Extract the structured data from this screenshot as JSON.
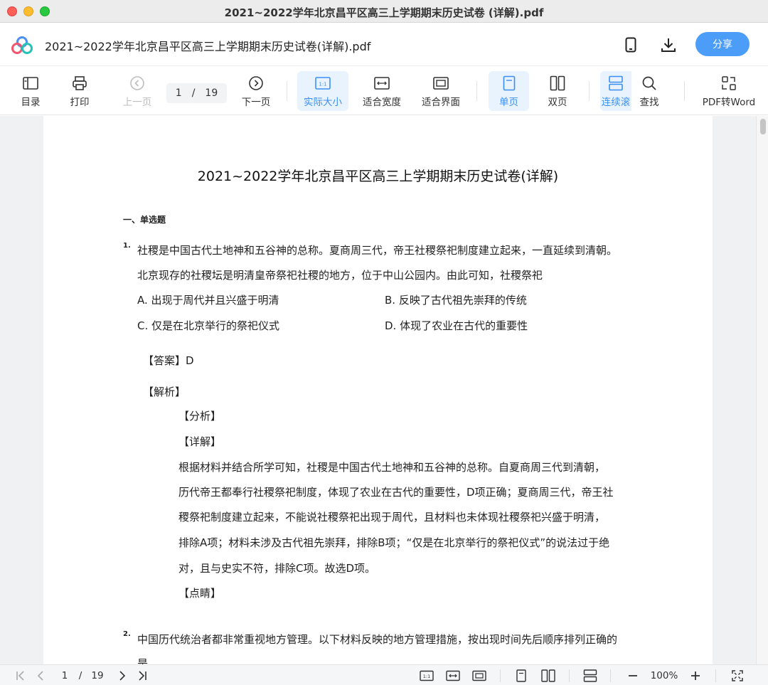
{
  "window": {
    "title": "2021~2022学年北京昌平区高三上学期期末历史试卷 (详解).pdf"
  },
  "header": {
    "doc_title": "2021~2022学年北京昌平区高三上学期期末历史试卷(详解).pdf",
    "share_label": "分享",
    "accent": "#4c9df8"
  },
  "toolbar": {
    "toc": "目录",
    "print": "打印",
    "prev_page": "上一页",
    "current_page": "1",
    "page_sep": "/",
    "total_pages": "19",
    "next_page": "下一页",
    "actual_size": "实际大小",
    "fit_width": "适合宽度",
    "fit_window": "适合界面",
    "single_page": "单页",
    "double_page": "双页",
    "continuous": "连续滚",
    "find": "查找",
    "pdf_to_word": "PDF转Word"
  },
  "document": {
    "title": "2021~2022学年北京昌平区高三上学期期末历史试卷(详解)",
    "section": "一、单选题",
    "q1": {
      "num": "1.",
      "stem_line1": "社稷是中国古代土地神和五谷神的总称。夏商周三代，帝王社稷祭祀制度建立起来，一直延续到清朝。",
      "stem_line2": "北京现存的社稷坛是明清皇帝祭祀社稷的地方，位于中山公园内。由此可知，社稷祭祀",
      "option_a": "A. 出现于周代并且兴盛于明清",
      "option_b": "B. 反映了古代祖先崇拜的传统",
      "option_c": "C. 仅是在北京举行的祭祀仪式",
      "option_d": "D. 体现了农业在古代的重要性",
      "answer": "【答案】D",
      "analysis_head": "【解析】",
      "fenxi": "【分析】",
      "xiangjie": "【详解】",
      "detail_1": "根据材料并结合所学可知，社稷是中国古代土地神和五谷神的总称。自夏商周三代到清朝，",
      "detail_2": "历代帝王都奉行社稷祭祀制度，体现了农业在古代的重要性，D项正确；夏商周三代，帝王社",
      "detail_3": "稷祭祀制度建立起来，不能说社稷祭祀出现于周代，且材料也未体现社稷祭祀兴盛于明清，",
      "detail_4": "排除A项；材料未涉及古代祖先崇拜，排除B项；“仅是在北京举行的祭祀仪式”的说法过于绝",
      "detail_5": "对，且与史实不符，排除C项。故选D项。",
      "dianjing": "【点睛】"
    },
    "q2": {
      "num": "2.",
      "stem_line1": "中国历代统治者都非常重视地方管理。以下材料反映的地方管理措施，按出现时间先后顺序排列正确的",
      "stem_line2": "是"
    }
  },
  "bottombar": {
    "current_page": "1",
    "page_sep": "/",
    "total_pages": "19",
    "zoom": "100%"
  }
}
